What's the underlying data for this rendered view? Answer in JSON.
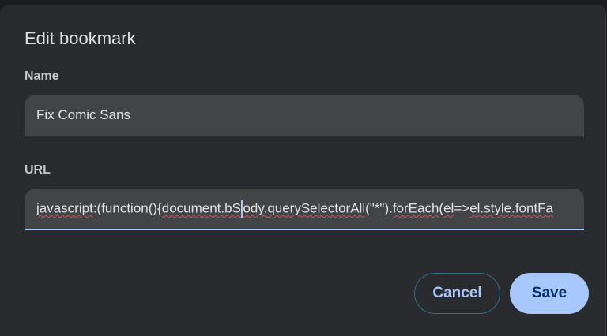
{
  "dialog": {
    "title": "Edit bookmark",
    "name_label": "Name",
    "name_value": "Fix Comic Sans",
    "url_label": "URL",
    "url_segments": [
      {
        "text": "javascript",
        "spell": true
      },
      {
        "text": ":(function(){",
        "spell": false
      },
      {
        "text": "document.bS",
        "spell": true
      },
      {
        "text": "ody.",
        "spell": true
      },
      {
        "text": "querySelectorAll",
        "spell": true
      },
      {
        "text": "(\"*\").",
        "spell": false
      },
      {
        "text": "forEach",
        "spell": true
      },
      {
        "text": "(",
        "spell": false
      },
      {
        "text": "el",
        "spell": true
      },
      {
        "text": "=>",
        "spell": false
      },
      {
        "text": "el.style.fontFa",
        "spell": true
      }
    ],
    "cancel_label": "Cancel",
    "save_label": "Save"
  },
  "colors": {
    "accent": "#a8c7fa",
    "save_text": "#062e6f",
    "dialog_bg": "#2a2b2f",
    "field_bg": "#434445"
  }
}
